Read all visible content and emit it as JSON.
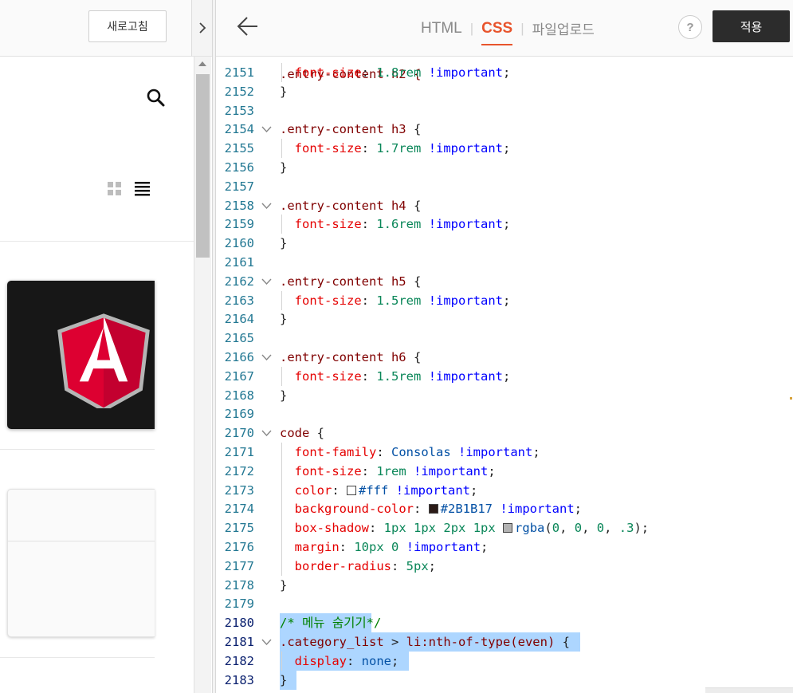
{
  "preview": {
    "refresh_label": "새로고침"
  },
  "editor": {
    "tabs": [
      {
        "label": "HTML",
        "active": false
      },
      {
        "label": "CSS",
        "active": true
      },
      {
        "label": "파일업로드",
        "active": false
      }
    ],
    "help_label": "?",
    "apply_label": "적용",
    "accent_color": "#e8542c"
  },
  "code": {
    "partial_top_line": ".entry-content h2 {",
    "lines": [
      {
        "num": "2151",
        "indent": true,
        "fold": false,
        "selected": false,
        "tokens": [
          [
            "prop",
            "font-size"
          ],
          [
            "p",
            ": "
          ],
          [
            "num",
            "1.8rem"
          ],
          [
            "p",
            " "
          ],
          [
            "kw",
            "!important"
          ],
          [
            "p",
            ";"
          ]
        ]
      },
      {
        "num": "2152",
        "indent": false,
        "fold": false,
        "selected": false,
        "tokens": [
          [
            "p",
            "}"
          ]
        ]
      },
      {
        "num": "2153",
        "indent": false,
        "fold": false,
        "selected": false,
        "tokens": []
      },
      {
        "num": "2154",
        "indent": false,
        "fold": true,
        "selected": false,
        "tokens": [
          [
            "sel",
            ".entry-content h3"
          ],
          [
            "p",
            " {"
          ]
        ]
      },
      {
        "num": "2155",
        "indent": true,
        "fold": false,
        "selected": false,
        "tokens": [
          [
            "prop",
            "font-size"
          ],
          [
            "p",
            ": "
          ],
          [
            "num",
            "1.7rem"
          ],
          [
            "p",
            " "
          ],
          [
            "kw",
            "!important"
          ],
          [
            "p",
            ";"
          ]
        ]
      },
      {
        "num": "2156",
        "indent": false,
        "fold": false,
        "selected": false,
        "tokens": [
          [
            "p",
            "}"
          ]
        ]
      },
      {
        "num": "2157",
        "indent": false,
        "fold": false,
        "selected": false,
        "tokens": []
      },
      {
        "num": "2158",
        "indent": false,
        "fold": true,
        "selected": false,
        "tokens": [
          [
            "sel",
            ".entry-content h4"
          ],
          [
            "p",
            " {"
          ]
        ]
      },
      {
        "num": "2159",
        "indent": true,
        "fold": false,
        "selected": false,
        "tokens": [
          [
            "prop",
            "font-size"
          ],
          [
            "p",
            ": "
          ],
          [
            "num",
            "1.6rem"
          ],
          [
            "p",
            " "
          ],
          [
            "kw",
            "!important"
          ],
          [
            "p",
            ";"
          ]
        ]
      },
      {
        "num": "2160",
        "indent": false,
        "fold": false,
        "selected": false,
        "tokens": [
          [
            "p",
            "}"
          ]
        ]
      },
      {
        "num": "2161",
        "indent": false,
        "fold": false,
        "selected": false,
        "tokens": []
      },
      {
        "num": "2162",
        "indent": false,
        "fold": true,
        "selected": false,
        "tokens": [
          [
            "sel",
            ".entry-content h5"
          ],
          [
            "p",
            " {"
          ]
        ]
      },
      {
        "num": "2163",
        "indent": true,
        "fold": false,
        "selected": false,
        "tokens": [
          [
            "prop",
            "font-size"
          ],
          [
            "p",
            ": "
          ],
          [
            "num",
            "1.5rem"
          ],
          [
            "p",
            " "
          ],
          [
            "kw",
            "!important"
          ],
          [
            "p",
            ";"
          ]
        ]
      },
      {
        "num": "2164",
        "indent": false,
        "fold": false,
        "selected": false,
        "tokens": [
          [
            "p",
            "}"
          ]
        ]
      },
      {
        "num": "2165",
        "indent": false,
        "fold": false,
        "selected": false,
        "tokens": []
      },
      {
        "num": "2166",
        "indent": false,
        "fold": true,
        "selected": false,
        "tokens": [
          [
            "sel",
            ".entry-content h6"
          ],
          [
            "p",
            " {"
          ]
        ]
      },
      {
        "num": "2167",
        "indent": true,
        "fold": false,
        "selected": false,
        "tokens": [
          [
            "prop",
            "font-size"
          ],
          [
            "p",
            ": "
          ],
          [
            "num",
            "1.5rem"
          ],
          [
            "p",
            " "
          ],
          [
            "kw",
            "!important"
          ],
          [
            "p",
            ";"
          ]
        ]
      },
      {
        "num": "2168",
        "indent": false,
        "fold": false,
        "selected": false,
        "tokens": [
          [
            "p",
            "}"
          ]
        ]
      },
      {
        "num": "2169",
        "indent": false,
        "fold": false,
        "selected": false,
        "tokens": []
      },
      {
        "num": "2170",
        "indent": false,
        "fold": true,
        "selected": false,
        "tokens": [
          [
            "sel",
            "code"
          ],
          [
            "p",
            " {"
          ]
        ]
      },
      {
        "num": "2171",
        "indent": true,
        "fold": false,
        "selected": false,
        "tokens": [
          [
            "prop",
            "font-family"
          ],
          [
            "p",
            ": "
          ],
          [
            "val",
            "Consolas"
          ],
          [
            "p",
            " "
          ],
          [
            "kw",
            "!important"
          ],
          [
            "p",
            ";"
          ]
        ]
      },
      {
        "num": "2172",
        "indent": true,
        "fold": false,
        "selected": false,
        "tokens": [
          [
            "prop",
            "font-size"
          ],
          [
            "p",
            ": "
          ],
          [
            "num",
            "1rem"
          ],
          [
            "p",
            " "
          ],
          [
            "kw",
            "!important"
          ],
          [
            "p",
            ";"
          ]
        ]
      },
      {
        "num": "2173",
        "indent": true,
        "fold": false,
        "selected": false,
        "tokens": [
          [
            "prop",
            "color"
          ],
          [
            "p",
            ": "
          ],
          [
            "swatch",
            "#ffffff"
          ],
          [
            "val",
            "#fff"
          ],
          [
            "p",
            " "
          ],
          [
            "kw",
            "!important"
          ],
          [
            "p",
            ";"
          ]
        ]
      },
      {
        "num": "2174",
        "indent": true,
        "fold": false,
        "selected": false,
        "tokens": [
          [
            "prop",
            "background-color"
          ],
          [
            "p",
            ": "
          ],
          [
            "swatch",
            "#2B1B17"
          ],
          [
            "val",
            "#2B1B17"
          ],
          [
            "p",
            " "
          ],
          [
            "kw",
            "!important"
          ],
          [
            "p",
            ";"
          ]
        ]
      },
      {
        "num": "2175",
        "indent": true,
        "fold": false,
        "selected": false,
        "tokens": [
          [
            "prop",
            "box-shadow"
          ],
          [
            "p",
            ": "
          ],
          [
            "num",
            "1px"
          ],
          [
            "p",
            " "
          ],
          [
            "num",
            "1px"
          ],
          [
            "p",
            " "
          ],
          [
            "num",
            "2px"
          ],
          [
            "p",
            " "
          ],
          [
            "num",
            "1px"
          ],
          [
            "p",
            " "
          ],
          [
            "swatch",
            "#b3b3b3"
          ],
          [
            "val",
            "rgba"
          ],
          [
            "p",
            "("
          ],
          [
            "num",
            "0"
          ],
          [
            "p",
            ", "
          ],
          [
            "num",
            "0"
          ],
          [
            "p",
            ", "
          ],
          [
            "num",
            "0"
          ],
          [
            "p",
            ", "
          ],
          [
            "num",
            ".3"
          ],
          [
            "p",
            ");"
          ]
        ]
      },
      {
        "num": "2176",
        "indent": true,
        "fold": false,
        "selected": false,
        "tokens": [
          [
            "prop",
            "margin"
          ],
          [
            "p",
            ": "
          ],
          [
            "num",
            "10px"
          ],
          [
            "p",
            " "
          ],
          [
            "num",
            "0"
          ],
          [
            "p",
            " "
          ],
          [
            "kw",
            "!important"
          ],
          [
            "p",
            ";"
          ]
        ]
      },
      {
        "num": "2177",
        "indent": true,
        "fold": false,
        "selected": false,
        "tokens": [
          [
            "prop",
            "border-radius"
          ],
          [
            "p",
            ": "
          ],
          [
            "num",
            "5px"
          ],
          [
            "p",
            ";"
          ]
        ]
      },
      {
        "num": "2178",
        "indent": false,
        "fold": false,
        "selected": false,
        "tokens": [
          [
            "p",
            "}"
          ]
        ]
      },
      {
        "num": "2179",
        "indent": false,
        "fold": false,
        "selected": false,
        "tokens": []
      },
      {
        "num": "2180",
        "indent": false,
        "fold": false,
        "selected": true,
        "tokens": [
          [
            "com",
            "/* 메뉴 숨기기*/"
          ]
        ]
      },
      {
        "num": "2181",
        "indent": false,
        "fold": true,
        "selected": true,
        "tokens": [
          [
            "sel",
            ".category_list"
          ],
          [
            "p",
            " > "
          ],
          [
            "sel",
            "li:nth-of-type(even)"
          ],
          [
            "p",
            " {"
          ]
        ]
      },
      {
        "num": "2182",
        "indent": true,
        "fold": false,
        "selected": true,
        "tokens": [
          [
            "prop",
            "display"
          ],
          [
            "p",
            ": "
          ],
          [
            "val",
            "none"
          ],
          [
            "p",
            ";"
          ]
        ]
      },
      {
        "num": "2183",
        "indent": false,
        "fold": false,
        "selected": true,
        "tokens": [
          [
            "p",
            "}"
          ]
        ]
      }
    ]
  }
}
